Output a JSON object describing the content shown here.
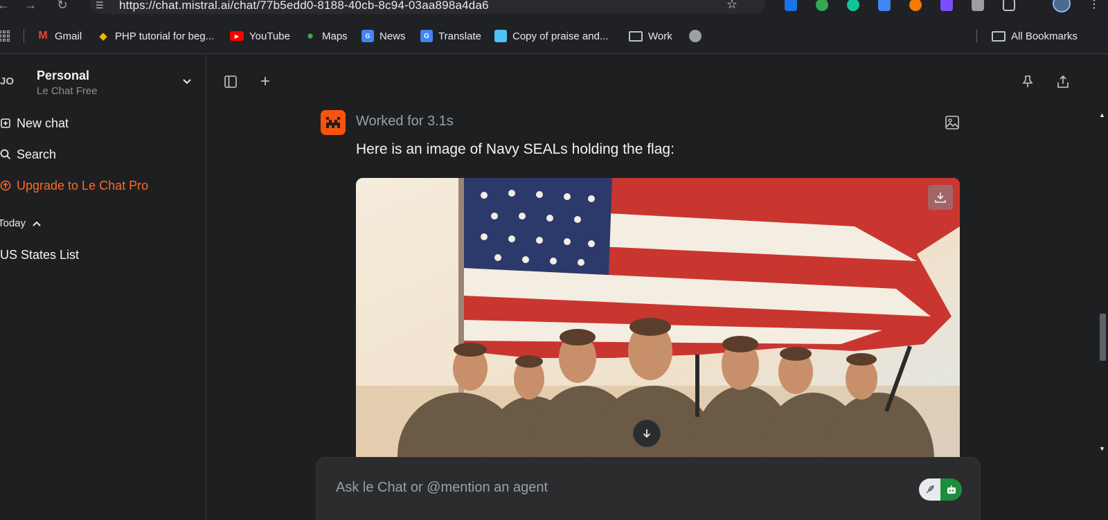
{
  "browser": {
    "url": "https://chat.mistral.ai/chat/77b5edd0-8188-40cb-8c94-03aa898a4da6",
    "bookmarks": [
      {
        "label": "Gmail",
        "icon": "gmail-icon",
        "color": "#ea4335"
      },
      {
        "label": "PHP tutorial for beg...",
        "icon": "php-icon",
        "color": "#f4b400"
      },
      {
        "label": "YouTube",
        "icon": "youtube-icon",
        "color": "#ff0000"
      },
      {
        "label": "Maps",
        "icon": "maps-icon",
        "color": "#34a853"
      },
      {
        "label": "News",
        "icon": "news-icon",
        "color": "#4285f4"
      },
      {
        "label": "Translate",
        "icon": "translate-icon",
        "color": "#4285f4"
      },
      {
        "label": "Copy of praise and...",
        "icon": "sheets-icon",
        "color": "#4fc3f7"
      },
      {
        "label": "Work",
        "icon": "folder-icon",
        "color": "#e8eaed"
      }
    ],
    "all_bookmarks": "All Bookmarks"
  },
  "sidebar": {
    "avatar_initials": "JO",
    "workspace_title": "Personal",
    "workspace_plan": "Le Chat Free",
    "new_chat": "New chat",
    "search": "Search",
    "upgrade": "Upgrade to Le Chat Pro",
    "section_today": "Today",
    "chats": [
      "US States List"
    ]
  },
  "message": {
    "status": "Worked for 3.1s",
    "text": "Here is an image of Navy SEALs holding the flag:"
  },
  "composer": {
    "placeholder": "Ask le Chat or @mention an agent"
  },
  "colors": {
    "accent": "#fa520f",
    "upgrade": "#ff6a2a",
    "background": "#1e1f20"
  }
}
